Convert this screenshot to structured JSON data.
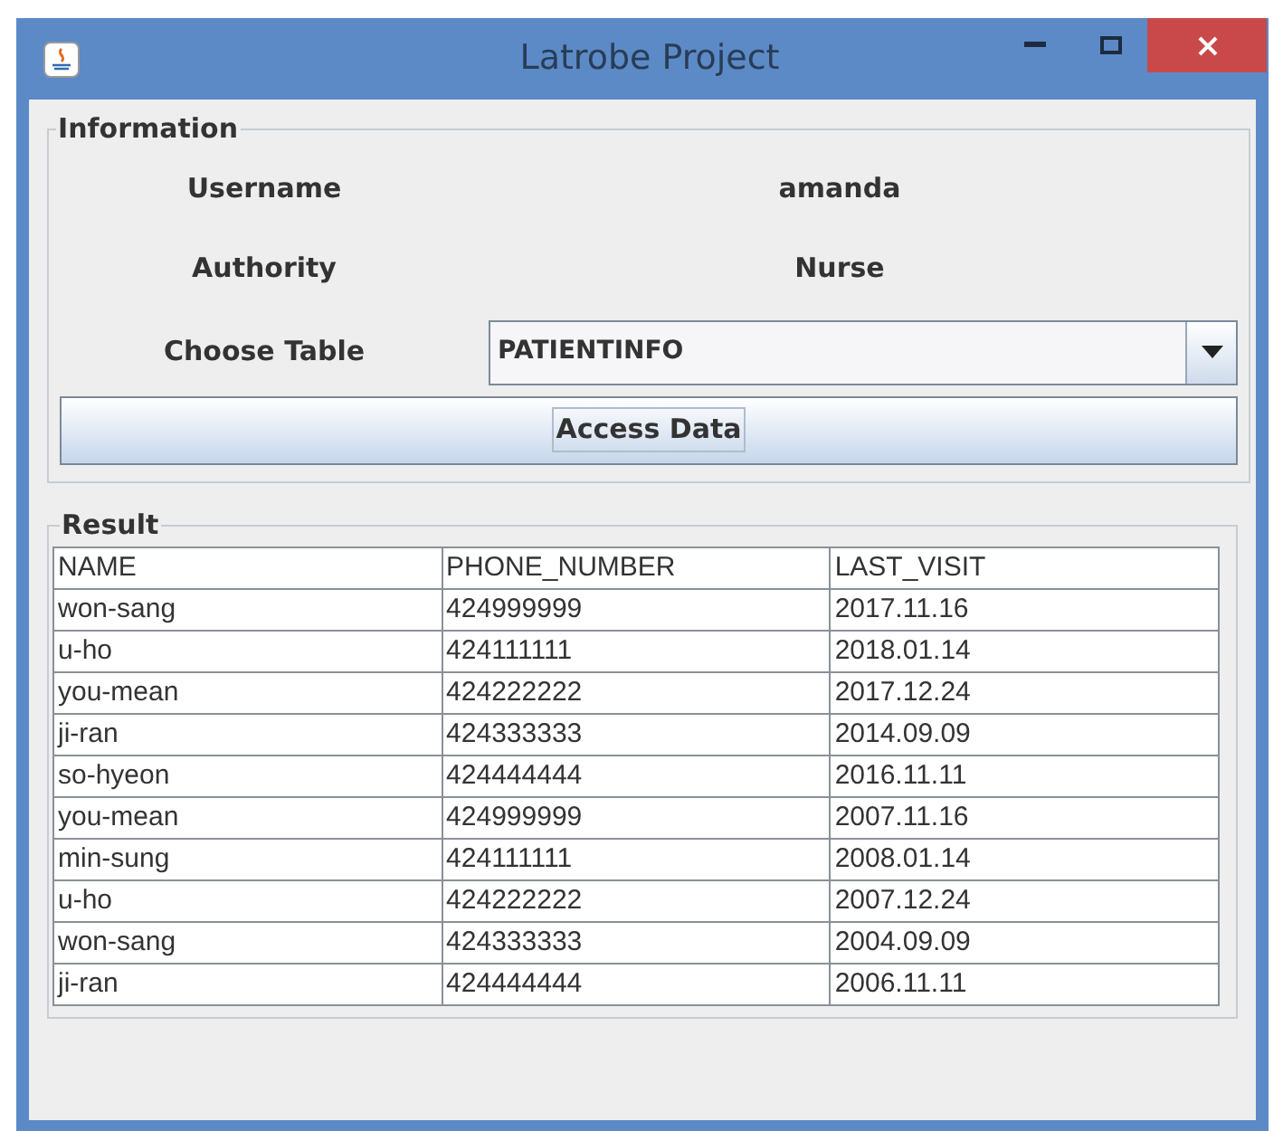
{
  "window": {
    "title": "Latrobe Project"
  },
  "information": {
    "title": "Information",
    "fields": [
      {
        "label": "Username",
        "value": "amanda"
      },
      {
        "label": "Authority",
        "value": "Nurse"
      }
    ],
    "choose_table": {
      "label": "Choose Table",
      "value": "PATIENTINFO"
    },
    "button": "Access Data"
  },
  "result": {
    "title": "Result",
    "columns": [
      "NAME",
      "PHONE_NUMBER",
      "LAST_VISIT"
    ],
    "rows": [
      [
        "won-sang",
        "424999999",
        "2017.11.16"
      ],
      [
        "u-ho",
        "424111111",
        "2018.01.14"
      ],
      [
        "you-mean",
        "424222222",
        "2017.12.24"
      ],
      [
        "ji-ran",
        "424333333",
        "2014.09.09"
      ],
      [
        "so-hyeon",
        "424444444",
        "2016.11.11"
      ],
      [
        "you-mean",
        "424999999",
        "2007.11.16"
      ],
      [
        "min-sung",
        "424111111",
        "2008.01.14"
      ],
      [
        "u-ho",
        "424222222",
        "2007.12.24"
      ],
      [
        "won-sang",
        "424333333",
        "2004.09.09"
      ],
      [
        "ji-ran",
        "424444444",
        "2006.11.11"
      ]
    ]
  }
}
